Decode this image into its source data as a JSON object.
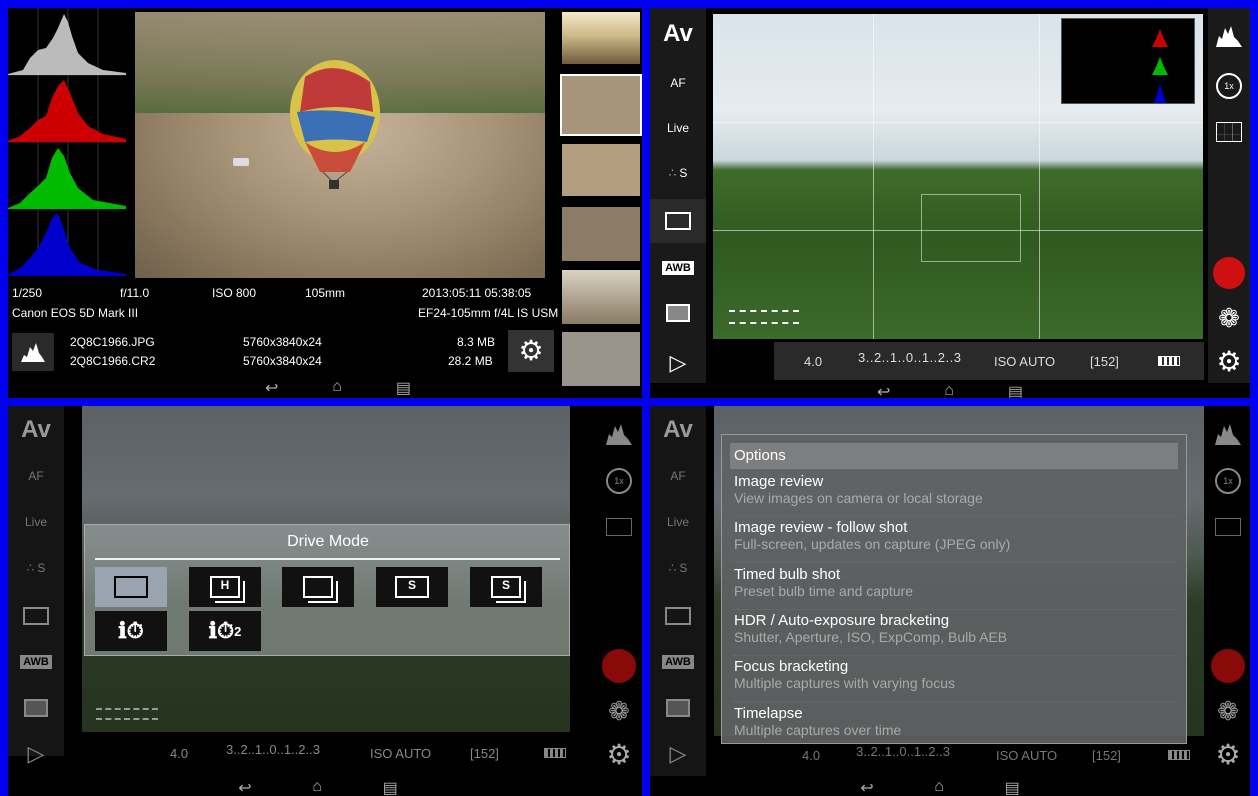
{
  "review": {
    "exposure": {
      "shutter": "1/250",
      "aperture": "f/11.0",
      "iso": "ISO 800",
      "focal": "105mm",
      "datetime": "2013:05:11 05:38:05"
    },
    "camera": "Canon EOS 5D Mark III",
    "lens": "EF24-105mm f/4L IS USM",
    "files": [
      {
        "name": "2Q8C1966.JPG",
        "dims": "5760x3840x24",
        "size": "8.3 MB"
      },
      {
        "name": "2Q8C1966.CR2",
        "dims": "5760x3840x24",
        "size": "28.2 MB"
      }
    ],
    "histogram_icon": "histogram-icon",
    "settings_icon": "gear-icon"
  },
  "live": {
    "mode": "Av",
    "af": "AF",
    "live": "Live",
    "metering": "S",
    "awb": "AWB",
    "bottom": {
      "aperture": "4.0",
      "ev_scale": "3..2..1..0..1..2..3",
      "iso": "ISO AUTO",
      "shots": "[152]"
    },
    "zoom": "1x"
  },
  "drive_mode": {
    "title": "Drive Mode",
    "options": [
      "single-shot",
      "high-speed-continuous",
      "low-speed-continuous",
      "silent-single",
      "silent-continuous",
      "self-timer-10s",
      "self-timer-2s"
    ],
    "h_label": "H",
    "s_label": "S",
    "timer2_sub": "2"
  },
  "options_menu": {
    "header": "Options",
    "items": [
      {
        "title": "Image review",
        "sub": "View images on camera or local storage"
      },
      {
        "title": "Image review - follow shot",
        "sub": "Full-screen, updates on capture (JPEG only)"
      },
      {
        "title": "Timed bulb shot",
        "sub": "Preset bulb time and capture"
      },
      {
        "title": "HDR / Auto-exposure bracketing",
        "sub": "Shutter, Aperture, ISO, ExpComp, Bulb AEB"
      },
      {
        "title": "Focus bracketing",
        "sub": "Multiple captures with varying focus"
      },
      {
        "title": "Timelapse",
        "sub": "Multiple captures over time"
      }
    ]
  },
  "colors": {
    "accent_record": "#d01010",
    "frame_blue": "#0000ee"
  }
}
